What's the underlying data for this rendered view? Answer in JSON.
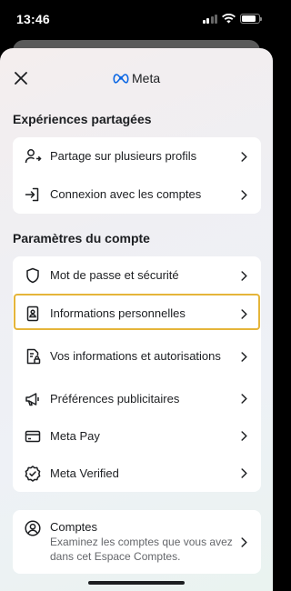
{
  "status_bar": {
    "time": "13:46",
    "battery_level": 0.85
  },
  "header": {
    "brand": "Meta",
    "close_icon": "close-icon",
    "logo_icon": "meta-logo-icon"
  },
  "shared_experiences": {
    "title": "Expériences partagées",
    "items": [
      {
        "label": "Partage sur plusieurs profils",
        "icon": "share-profiles-icon"
      },
      {
        "label": "Connexion avec les comptes",
        "icon": "login-icon"
      }
    ]
  },
  "account_settings": {
    "title": "Paramètres du compte",
    "items": [
      {
        "label": "Mot de passe et sécurité",
        "icon": "shield-icon"
      },
      {
        "label": "Informations personnelles",
        "icon": "id-card-icon",
        "highlighted": true
      },
      {
        "label": "Vos informations et autorisations",
        "icon": "data-permissions-icon"
      },
      {
        "label": "Préférences publicitaires",
        "icon": "megaphone-icon"
      },
      {
        "label": "Meta Pay",
        "icon": "card-icon"
      },
      {
        "label": "Meta Verified",
        "icon": "verified-badge-icon"
      }
    ]
  },
  "accounts": {
    "label": "Comptes",
    "description": "Examinez les comptes que vous avez dans cet Espace Comptes.",
    "icon": "account-icon"
  },
  "colors": {
    "highlight": "#e5b53a",
    "text": "#1c1e21",
    "secondary": "#65676b"
  }
}
